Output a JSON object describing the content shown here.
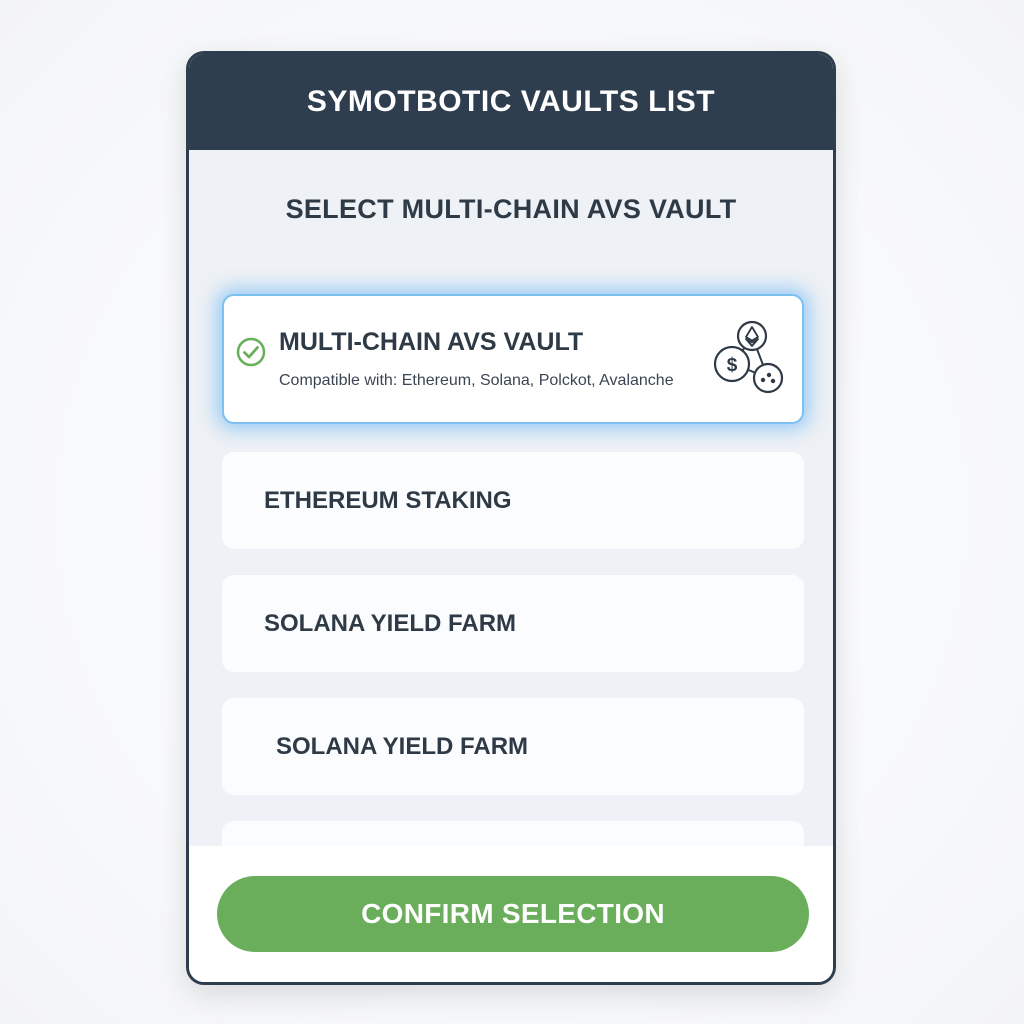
{
  "header": {
    "title": "SYMOTBOTIC VAULTS LIST"
  },
  "subtitle": "SELECT MULTI-CHAIN AVS VAULT",
  "vaults": [
    {
      "label": "MULTI-CHAIN AVS VAULT",
      "description": "Compatible with: Ethereum, Solana, Polckot, Avalanche",
      "selected": true,
      "icon": "multi-chain-icon"
    },
    {
      "label": "ETHEREUM STAKING",
      "selected": false
    },
    {
      "label": "SOLANA YIELD FARM",
      "selected": false
    },
    {
      "label": "SOLANA YIELD FARM",
      "selected": false
    },
    {
      "label": "",
      "selected": false
    }
  ],
  "confirm_button": {
    "label": "CONFIRM SELECTION"
  },
  "colors": {
    "header_bg": "#2f3e4f",
    "accent_green": "#6aae5c",
    "selection_glow": "#5aaff5"
  }
}
